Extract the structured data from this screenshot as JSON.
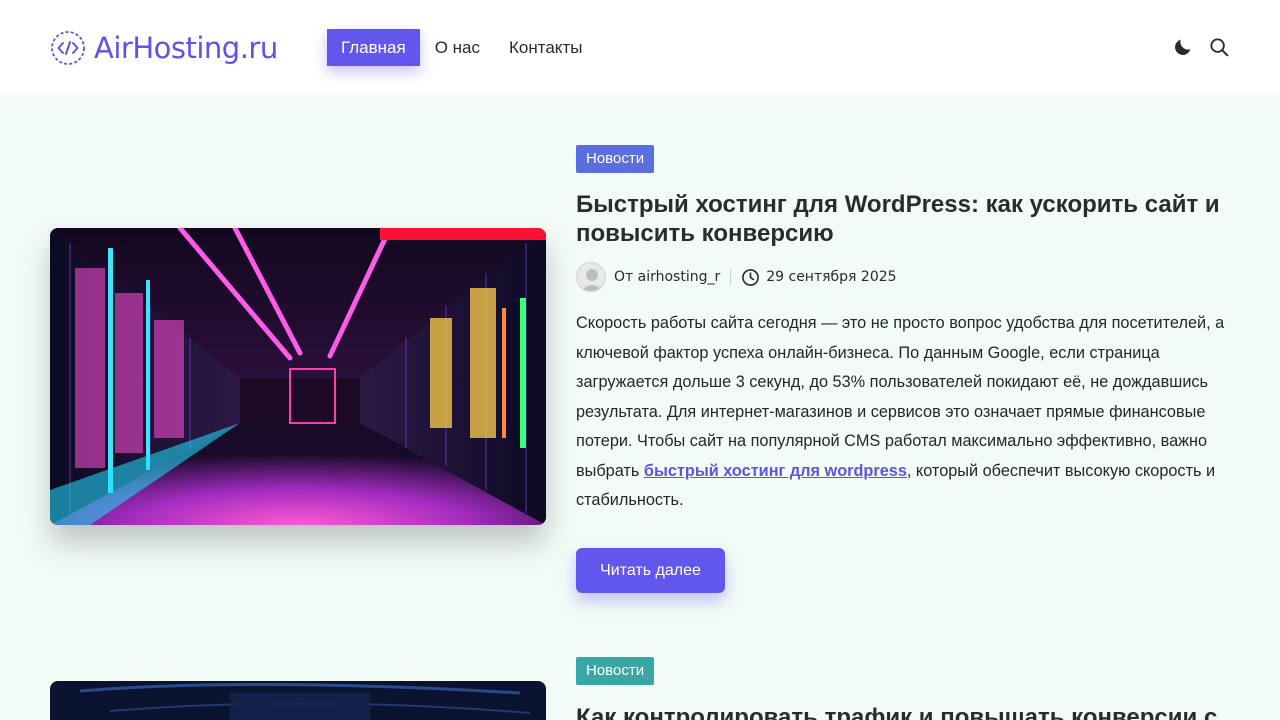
{
  "site": {
    "logo_text": "AirHosting.ru"
  },
  "nav": {
    "items": [
      {
        "label": "Главная",
        "active": true
      },
      {
        "label": "О нас",
        "active": false
      },
      {
        "label": "Контакты",
        "active": false
      }
    ]
  },
  "header_icons": {
    "theme_toggle": "moon-icon",
    "search": "search-icon"
  },
  "colors": {
    "accent": "#6257ec",
    "badge1": "#5a6ee0",
    "badge2": "#3aa7a6",
    "page_bg": "#f3fbf7"
  },
  "posts": [
    {
      "category": "Новости",
      "title": "Быстрый хостинг для WordPress: как ускорить сайт и повысить конверсию",
      "author": "От airhosting_r",
      "date": "29 сентября 2025",
      "excerpt_before": "Скорость работы сайта сегодня — это не просто вопрос удобства для посетителей, а ключевой фактор успеха онлайн-бизнеса. По данным Google, если страница загружается дольше 3 секунд, до 53% пользователей покидают её, не дождавшись результата. Для интернет-магазинов и сервисов это означает прямые финансовые потери. Чтобы сайт на популярной CMS работал максимально эффективно, важно выбрать ",
      "excerpt_link": "быстрый хостинг для wordpress",
      "excerpt_after": ", который обеспечит высокую скорость и стабильность.",
      "read_more": "Читать далее"
    },
    {
      "category": "Новости",
      "title": "Как контролировать трафик и повышать конверсии с"
    }
  ]
}
